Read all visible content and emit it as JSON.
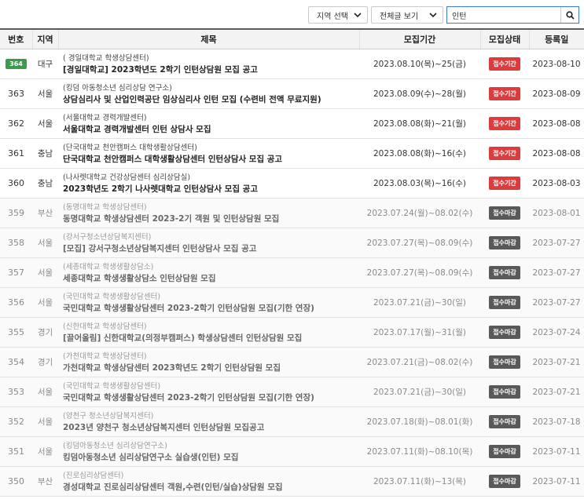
{
  "toolbar": {
    "region_select": "지역 선택",
    "view_select": "전체글 보기",
    "search_value": "인턴",
    "search_icon": "search-icon"
  },
  "table": {
    "headers": {
      "number": "번호",
      "region": "지역",
      "title": "제목",
      "period": "모집기간",
      "status": "모집상태",
      "date": "등록일"
    },
    "rows": [
      {
        "number": "364",
        "is_new": true,
        "region": "대구",
        "org": "( 경일대학교 학생상담센터)",
        "title": "[경일대학교] 2023학년도 2학기 인턴상담원 모집 공고",
        "period": "2023.08.10(목)~25(금)",
        "status": "접수기간",
        "status_type": "open",
        "date": "2023-08-10"
      },
      {
        "number": "363",
        "is_new": false,
        "region": "서울",
        "org": "(킹덤 아동청소년 심리상담 연구소)",
        "title": "상담심리사 및 산업인력공단 임상심리사 인턴 모집 (수련비 전액 무료지원)",
        "period": "2023.08.09(수)~28(월)",
        "status": "접수기간",
        "status_type": "open",
        "date": "2023-08-09"
      },
      {
        "number": "362",
        "is_new": false,
        "region": "서울",
        "org": "(서울대학교 경력개발센터)",
        "title": "서울대학교 경력개발센터 인턴 상담사 모집",
        "period": "2023.08.08(화)~21(월)",
        "status": "접수기간",
        "status_type": "open",
        "date": "2023-08-08"
      },
      {
        "number": "361",
        "is_new": false,
        "region": "충남",
        "org": "(단국대학교 천안캠퍼스 대학생활상담센터)",
        "title": "단국대학교 천안캠퍼스 대학생활상담센터 인턴상담사 모집 공고",
        "period": "2023.08.08(화)~16(수)",
        "status": "접수기간",
        "status_type": "open",
        "date": "2023-08-08"
      },
      {
        "number": "360",
        "is_new": false,
        "region": "충남",
        "org": "(나사렛대학교 건강상담센터 심리상담실)",
        "title": "2023학년도 2학기 나사렛대학교 인턴상담사 모집 공고",
        "period": "2023.08.03(목)~16(수)",
        "status": "접수기간",
        "status_type": "open",
        "date": "2023-08-03"
      },
      {
        "number": "359",
        "is_new": false,
        "region": "부산",
        "org": "(동명대학교 학생상담센터)",
        "title": "동명대학교 학생상담센터 2023-2기 객원 및 인턴상담원 모집",
        "period": "2023.07.24(월)~08.02(수)",
        "status": "접수마감",
        "status_type": "closed",
        "date": "2023-08-01"
      },
      {
        "number": "358",
        "is_new": false,
        "region": "서울",
        "org": "(강서구청소년상담복지센터)",
        "title": "[모집] 강서구청소년상담복지센터 인턴상담사 모집 공고",
        "period": "2023.07.27(목)~08.09(수)",
        "status": "접수마감",
        "status_type": "closed",
        "date": "2023-07-27"
      },
      {
        "number": "357",
        "is_new": false,
        "region": "서울",
        "org": "(세종대학교 학생생활상담소)",
        "title": "세종대학교 학생생활상담소 인턴상담원 모집",
        "period": "2023.07.27(목)~08.09(수)",
        "status": "접수마감",
        "status_type": "closed",
        "date": "2023-07-27"
      },
      {
        "number": "356",
        "is_new": false,
        "region": "서울",
        "org": "(국민대학교 학생생활상담센터)",
        "title": "국민대학교 학생생활상담센터 2023-2학기 인턴상담원 모집(기한 연장)",
        "period": "2023.07.21(금)~30(일)",
        "status": "접수마감",
        "status_type": "closed",
        "date": "2023-07-27"
      },
      {
        "number": "355",
        "is_new": false,
        "region": "경기",
        "org": "(신한대학교 학생상담센터)",
        "title": "[끌어올림] 신한대학교(의정부캠퍼스) 학생상담센터 인턴상담원 모집",
        "period": "2023.07.17(월)~31(월)",
        "status": "접수마감",
        "status_type": "closed",
        "date": "2023-07-24"
      },
      {
        "number": "354",
        "is_new": false,
        "region": "경기",
        "org": "(가천대학교 학생상담센터)",
        "title": "가천대학교 학생상담센터 2023학년도 2학기 인턴상담원 모집",
        "period": "2023.07.21(금)~08.02(수)",
        "status": "접수마감",
        "status_type": "closed",
        "date": "2023-07-21"
      },
      {
        "number": "353",
        "is_new": false,
        "region": "서울",
        "org": "(국민대학교 학생생활상담센터)",
        "title": "국민대학교 학생생활상담센터 2023-2학기 인턴상담원 모집(기한 연장)",
        "period": "2023.07.21(금)~30(일)",
        "status": "접수마감",
        "status_type": "closed",
        "date": "2023-07-21"
      },
      {
        "number": "352",
        "is_new": false,
        "region": "서울",
        "org": "(양천구 청소년상담복지센터)",
        "title": "2023년 양천구 청소년상담복지센터 인턴상담원 모집공고",
        "period": "2023.07.18(화)~08.01(화)",
        "status": "접수마감",
        "status_type": "closed",
        "date": "2023-07-18"
      },
      {
        "number": "351",
        "is_new": false,
        "region": "서울",
        "org": "(킹덤아동청소년 심리상담연구소)",
        "title": "킹덤아동청소년 심리상담연구소 실습생(인턴) 모집",
        "period": "2023.07.11(화)~08.10(목)",
        "status": "접수마감",
        "status_type": "closed",
        "date": "2023-07-11"
      },
      {
        "number": "350",
        "is_new": false,
        "region": "부산",
        "org": "(진로심리상담센터)",
        "title": "경성대학교 진로심리상담센터 객원,수련(인턴/실습)상담원 모집",
        "period": "2023.07.11(화)~13(목)",
        "status": "접수마감",
        "status_type": "closed",
        "date": "2023-07-11"
      }
    ]
  }
}
